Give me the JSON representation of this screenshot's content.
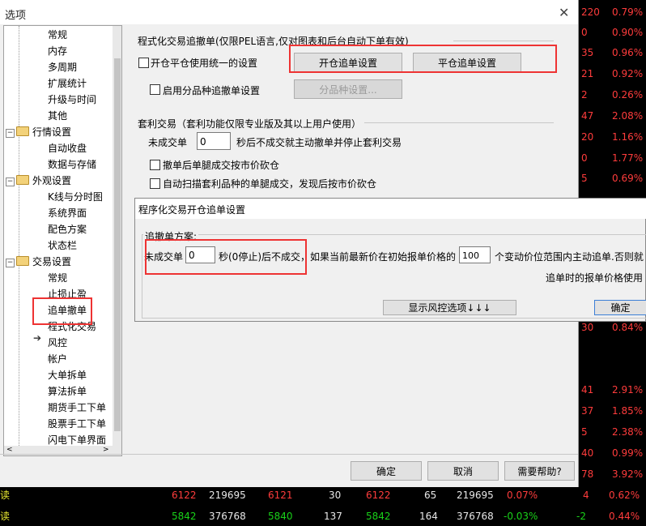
{
  "window": {
    "title": "选项"
  },
  "tree": {
    "items": [
      {
        "label": "常规",
        "indent": 2
      },
      {
        "label": "内存",
        "indent": 2
      },
      {
        "label": "多周期",
        "indent": 2
      },
      {
        "label": "扩展统计",
        "indent": 2
      },
      {
        "label": "升级与时间",
        "indent": 2
      },
      {
        "label": "其他",
        "indent": 2
      },
      {
        "label": "行情设置",
        "indent": 1
      },
      {
        "label": "自动收盘",
        "indent": 2
      },
      {
        "label": "数据与存储",
        "indent": 2
      },
      {
        "label": "外观设置",
        "indent": 1
      },
      {
        "label": "K线与分时图",
        "indent": 2
      },
      {
        "label": "系统界面",
        "indent": 2
      },
      {
        "label": "配色方案",
        "indent": 2
      },
      {
        "label": "状态栏",
        "indent": 2
      },
      {
        "label": "交易设置",
        "indent": 1
      },
      {
        "label": "常规",
        "indent": 2
      },
      {
        "label": "止损止盈",
        "indent": 2
      },
      {
        "label": "追单撤单",
        "indent": 2
      },
      {
        "label": "程式化交易",
        "indent": 2
      },
      {
        "label": "风控",
        "indent": 2
      },
      {
        "label": "帐户",
        "indent": 2
      },
      {
        "label": "大单拆单",
        "indent": 2
      },
      {
        "label": "算法拆单",
        "indent": 2
      },
      {
        "label": "期货手工下单",
        "indent": 2
      },
      {
        "label": "股票手工下单",
        "indent": 2
      },
      {
        "label": "闪电下单界面",
        "indent": 2
      }
    ]
  },
  "panel": {
    "section1_title": "程式化交易追撤单(仅限PEL语言,仅对图表和后台自动下单有效)",
    "chk_unified": "开仓平仓使用统一的设置",
    "btn_open": "开仓追单设置",
    "btn_close": "平仓追单设置",
    "chk_variety": "启用分品种追撤单设置",
    "btn_variety": "分品种设置...",
    "section2_title": "套利交易（套利功能仅限专业版及其以上用户使用）",
    "unfilled_label": "未成交单",
    "unfilled_value": "0",
    "unfilled_suffix": "秒后不成交就主动撤单并停止套利交易",
    "chk_cancel_leg": "撤单后单腿成交按市价砍仓",
    "chk_auto_scan": "自动扫描套利品种的单腿成交，发现后按市价砍仓"
  },
  "dialog": {
    "title": "程序化交易开仓追单设置",
    "group_label": "追撤单方案:",
    "unfilled_label": "未成交单",
    "seconds_value": "0",
    "seconds_suffix": "秒(0停止)后不成交，如果当前最新价在初始报单价格的",
    "ticks_value": "100",
    "ticks_suffix": "个变动价位范围内主动追单.否则就",
    "line2": "追单时的报单价格使用",
    "btn_risk": "显示风控选项↓↓↓",
    "btn_ok": "确定"
  },
  "footer": {
    "ok": "确定",
    "cancel": "取消",
    "help": "需要帮助?"
  },
  "quotes_right": [
    {
      "left": "220",
      "val": "0.79%",
      "c": "r"
    },
    {
      "left": "0",
      "val": "0.90%",
      "c": "r"
    },
    {
      "left": "35",
      "val": "0.96%",
      "c": "r"
    },
    {
      "left": "21",
      "val": "0.92%",
      "c": "r"
    },
    {
      "left": "2",
      "val": "0.26%",
      "c": "r"
    },
    {
      "left": "47",
      "val": "2.08%",
      "c": "r"
    },
    {
      "left": "20",
      "val": "1.16%",
      "c": "r"
    },
    {
      "left": "0",
      "val": "1.77%",
      "c": "r"
    },
    {
      "left": "5",
      "val": "0.69%",
      "c": "r"
    },
    {
      "left": "30",
      "val": "0.84%",
      "c": "r"
    },
    {
      "left": "41",
      "val": "2.91%",
      "c": "r"
    },
    {
      "left": "37",
      "val": "1.85%",
      "c": "r"
    },
    {
      "left": "5",
      "val": "2.38%",
      "c": "r"
    },
    {
      "left": "40",
      "val": "0.99%",
      "c": "r"
    },
    {
      "left": "78",
      "val": "3.92%",
      "c": "r"
    }
  ],
  "quotes_bottom": [
    {
      "name": "读",
      "c1": "6122",
      "c2": "219695",
      "c3": "6121",
      "c4": "30",
      "c5": "6122",
      "c6": "65",
      "c7": "219695",
      "c8": "0.07%",
      "c9": "4",
      "c10": "0.62%"
    },
    {
      "name": "读",
      "c1": "5842",
      "c2": "376768",
      "c3": "5840",
      "c4": "137",
      "c5": "5842",
      "c6": "164",
      "c7": "376768",
      "c8": "-0.03%",
      "c9": "-2",
      "c10": "0.44%"
    }
  ]
}
